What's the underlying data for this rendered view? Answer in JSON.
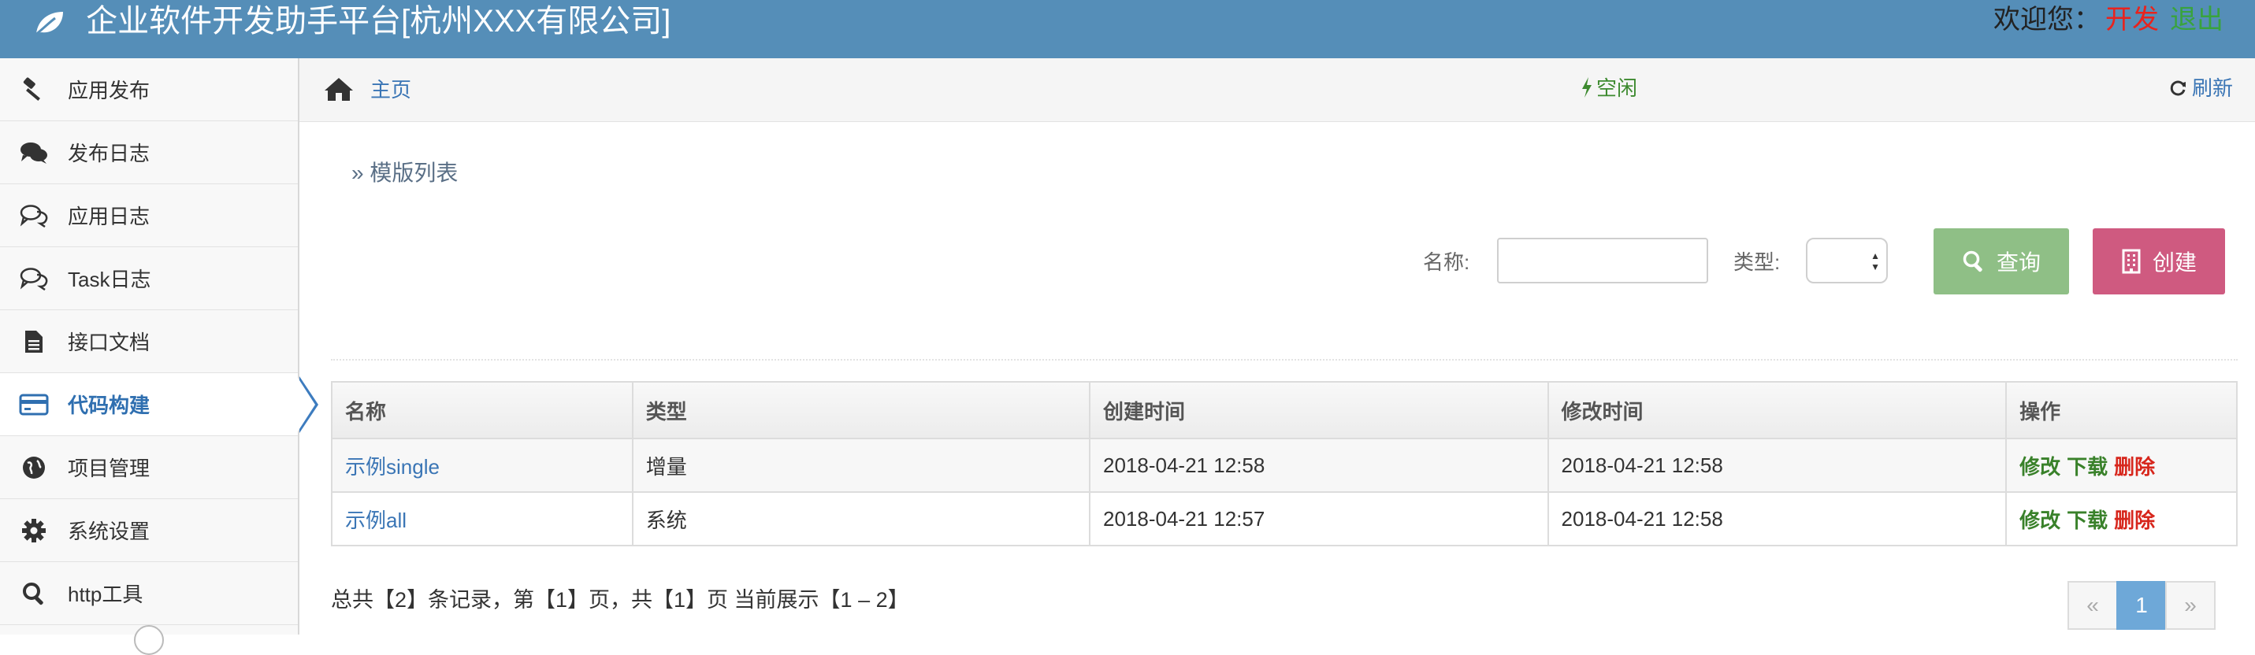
{
  "app": {
    "title": "企业软件开发助手平台[杭州XXX有限公司]",
    "welcome": "欢迎您：",
    "env": "开发",
    "logout": "退出"
  },
  "sidebar": {
    "items": [
      {
        "label": "应用发布",
        "icon": "gavel-icon"
      },
      {
        "label": "发布日志",
        "icon": "comments-icon"
      },
      {
        "label": "应用日志",
        "icon": "comments-outline-icon"
      },
      {
        "label": "Task日志",
        "icon": "comments-outline-icon"
      },
      {
        "label": "接口文档",
        "icon": "file-text-icon"
      },
      {
        "label": "代码构建",
        "icon": "credit-card-icon",
        "active": true
      },
      {
        "label": "项目管理",
        "icon": "globe-icon"
      },
      {
        "label": "系统设置",
        "icon": "gear-icon"
      },
      {
        "label": "http工具",
        "icon": "search-icon"
      }
    ]
  },
  "breadcrumb": {
    "home": "主页",
    "status": "空闲",
    "refresh": "刷新"
  },
  "section": {
    "title": "» 模版列表"
  },
  "filters": {
    "name_label": "名称:",
    "name_value": "",
    "type_label": "类型:",
    "type_value": "",
    "search_button": "查询",
    "create_button": "创建"
  },
  "table": {
    "headers": [
      "名称",
      "类型",
      "创建时间",
      "修改时间",
      "操作"
    ],
    "rows": [
      {
        "name": "示例single",
        "type": "增量",
        "created": "2018-04-21 12:58",
        "modified": "2018-04-21 12:58"
      },
      {
        "name": "示例all",
        "type": "系统",
        "created": "2018-04-21 12:57",
        "modified": "2018-04-21 12:58"
      }
    ],
    "actions": {
      "edit": "修改",
      "download": "下载",
      "delete": "删除"
    }
  },
  "pagination": {
    "summary": "总共【2】条记录，第【1】页，共【1】页 当前展示【1 – 2】",
    "prev": "«",
    "current": "1",
    "next": "»"
  },
  "colors": {
    "navbar": "#558eb8",
    "active_menu": "#2f6fb0",
    "search_button": "#8fbf86",
    "create_button": "#cf5a80",
    "env_text": "#e8231d",
    "logout_text": "#39a33d",
    "status_text": "#3d8a2f",
    "delete_text": "#d7261c"
  }
}
